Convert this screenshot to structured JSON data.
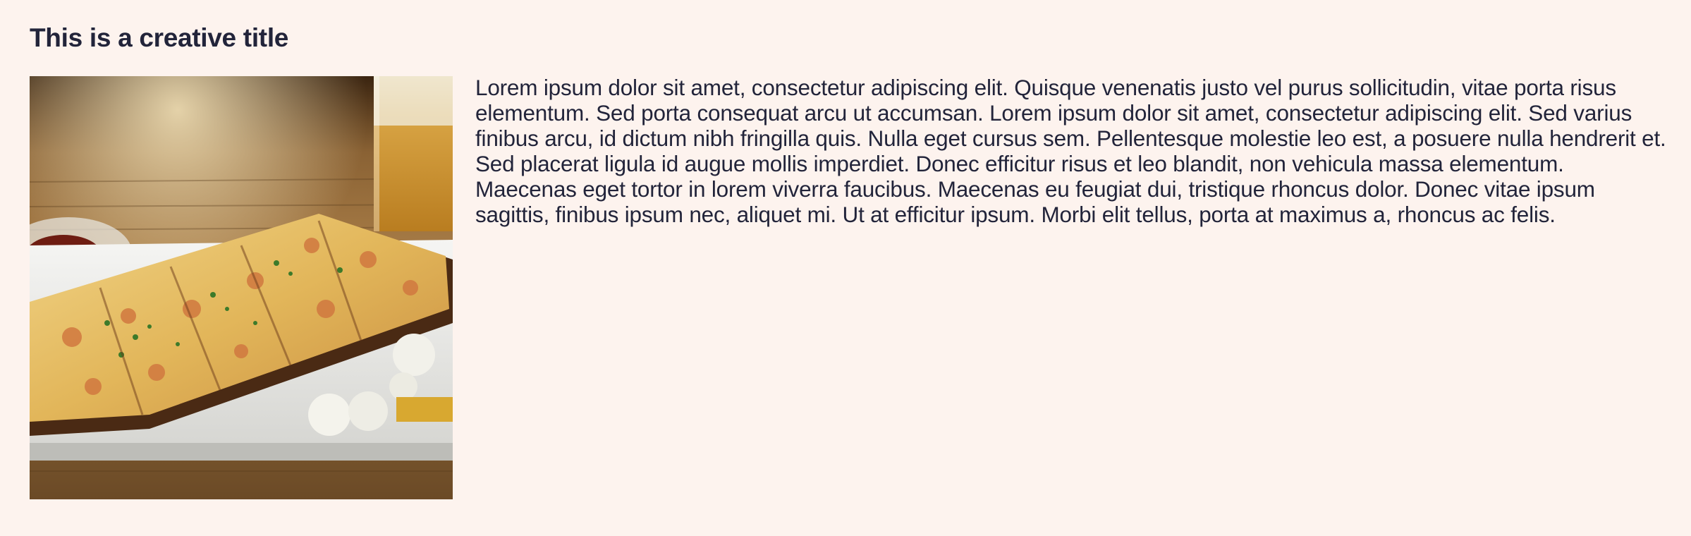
{
  "article": {
    "title": "This is a creative title",
    "body": "Lorem ipsum dolor sit amet, consectetur adipiscing elit. Quisque venenatis justo vel purus sollicitudin, vitae porta risus elementum. Sed porta consequat arcu ut accumsan. Lorem ipsum dolor sit amet, consectetur adipiscing elit. Sed varius finibus arcu, id dictum nibh fringilla quis. Nulla eget cursus sem. Pellentesque molestie leo est, a posuere nulla hendrerit et. Sed placerat ligula id augue mollis imperdiet. Donec efficitur risus et leo blandit, non vehicula massa elementum. Maecenas eget tortor in lorem viverra faucibus. Maecenas eu feugiat dui, tristique rhoncus dolor. Donec vitae ipsum sagittis, finibus ipsum nec, aliquet mi. Ut at efficitur ipsum. Morbi elit tellus, porta at maximus a, rhoncus ac felis."
  },
  "colors": {
    "background": "#fdf3ee",
    "text": "#22243a"
  }
}
